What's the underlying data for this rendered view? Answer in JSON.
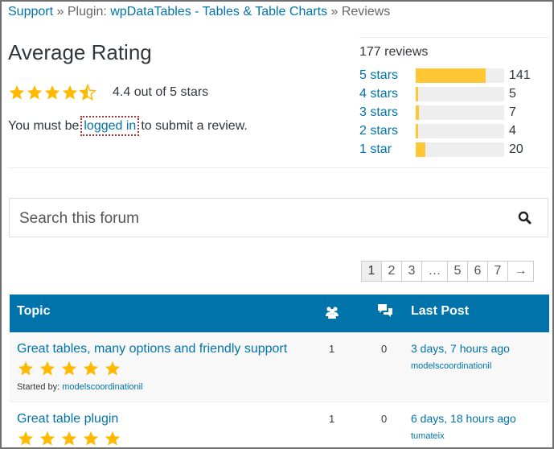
{
  "breadcrumb": {
    "support": "Support",
    "sep": "»",
    "plugin_prefix": "Plugin:",
    "plugin_name": "wpDataTables - Tables & Table Charts",
    "current": "Reviews"
  },
  "rating": {
    "title": "Average Rating",
    "stars_value": 4.4,
    "text": "4.4 out of 5 stars",
    "login_prefix": "You must be",
    "login_link": "logged in",
    "login_suffix": "to submit a review."
  },
  "breakdown": {
    "total": "177 reviews",
    "rows": [
      {
        "label": "5 stars",
        "count": "141",
        "fraction": 0.794
      },
      {
        "label": "4 stars",
        "count": "5",
        "fraction": 0.028
      },
      {
        "label": "3 stars",
        "count": "7",
        "fraction": 0.04
      },
      {
        "label": "2 stars",
        "count": "4",
        "fraction": 0.023
      },
      {
        "label": "1 star",
        "count": "20",
        "fraction": 0.113
      }
    ]
  },
  "search": {
    "placeholder": "Search this forum",
    "icon": "search-icon"
  },
  "pagination": {
    "pages": [
      "1",
      "2",
      "3",
      "…",
      "5",
      "6",
      "7",
      "→"
    ],
    "current": "1"
  },
  "table": {
    "headers": {
      "topic": "Topic",
      "voices_icon": "voices-icon",
      "posts_icon": "posts-icon",
      "last_post": "Last Post"
    },
    "rows": [
      {
        "title": "Great tables, many options and friendly support",
        "stars": 5,
        "started_by_label": "Started by:",
        "started_by": "modelscoordinationil",
        "voices": "1",
        "posts": "0",
        "last_time": "3 days, 7 hours ago",
        "last_user": "modelscoordinationil"
      },
      {
        "title": "Great table plugin",
        "stars": 5,
        "voices": "1",
        "posts": "0",
        "last_time": "6 days, 18 hours ago",
        "last_user": "tumateix"
      }
    ]
  },
  "colors": {
    "accent": "#0073aa",
    "star": "#ffb900",
    "bar_fill": "#ffc733",
    "bar_track": "#eeeeee"
  }
}
